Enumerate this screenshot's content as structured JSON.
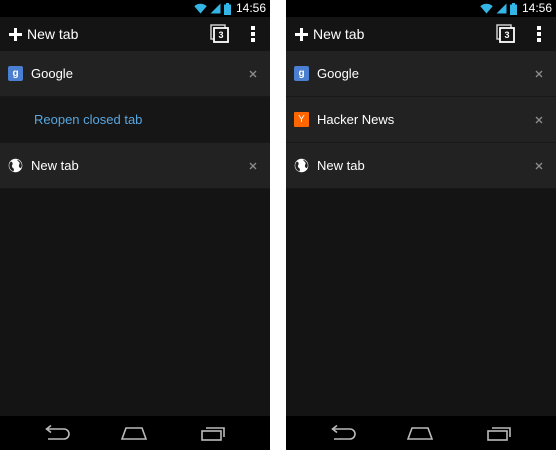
{
  "left_screen": {
    "status": {
      "time": "14:56"
    },
    "toolbar": {
      "new_tab_label": "New tab",
      "tab_count": "3"
    },
    "tabs": [
      {
        "title": "Google",
        "favicon": "google-favicon",
        "favicon_letter": "g"
      },
      {
        "reopen_label": "Reopen closed tab"
      },
      {
        "title": "New tab",
        "favicon": "globe-icon"
      }
    ]
  },
  "right_screen": {
    "status": {
      "time": "14:56"
    },
    "toolbar": {
      "new_tab_label": "New tab",
      "tab_count": "3"
    },
    "tabs": [
      {
        "title": "Google",
        "favicon": "google-favicon",
        "favicon_letter": "g"
      },
      {
        "title": "Hacker News",
        "favicon": "hacker-news-favicon",
        "favicon_letter": "Y"
      },
      {
        "title": "New tab",
        "favicon": "globe-icon"
      }
    ]
  },
  "colors": {
    "background": "#141414",
    "tab_row": "#222222",
    "reopen_link": "#58a6e0",
    "status_icons": "#33b5e5",
    "hacker_news": "#ff6600",
    "google_favicon": "#4a7fd1"
  }
}
